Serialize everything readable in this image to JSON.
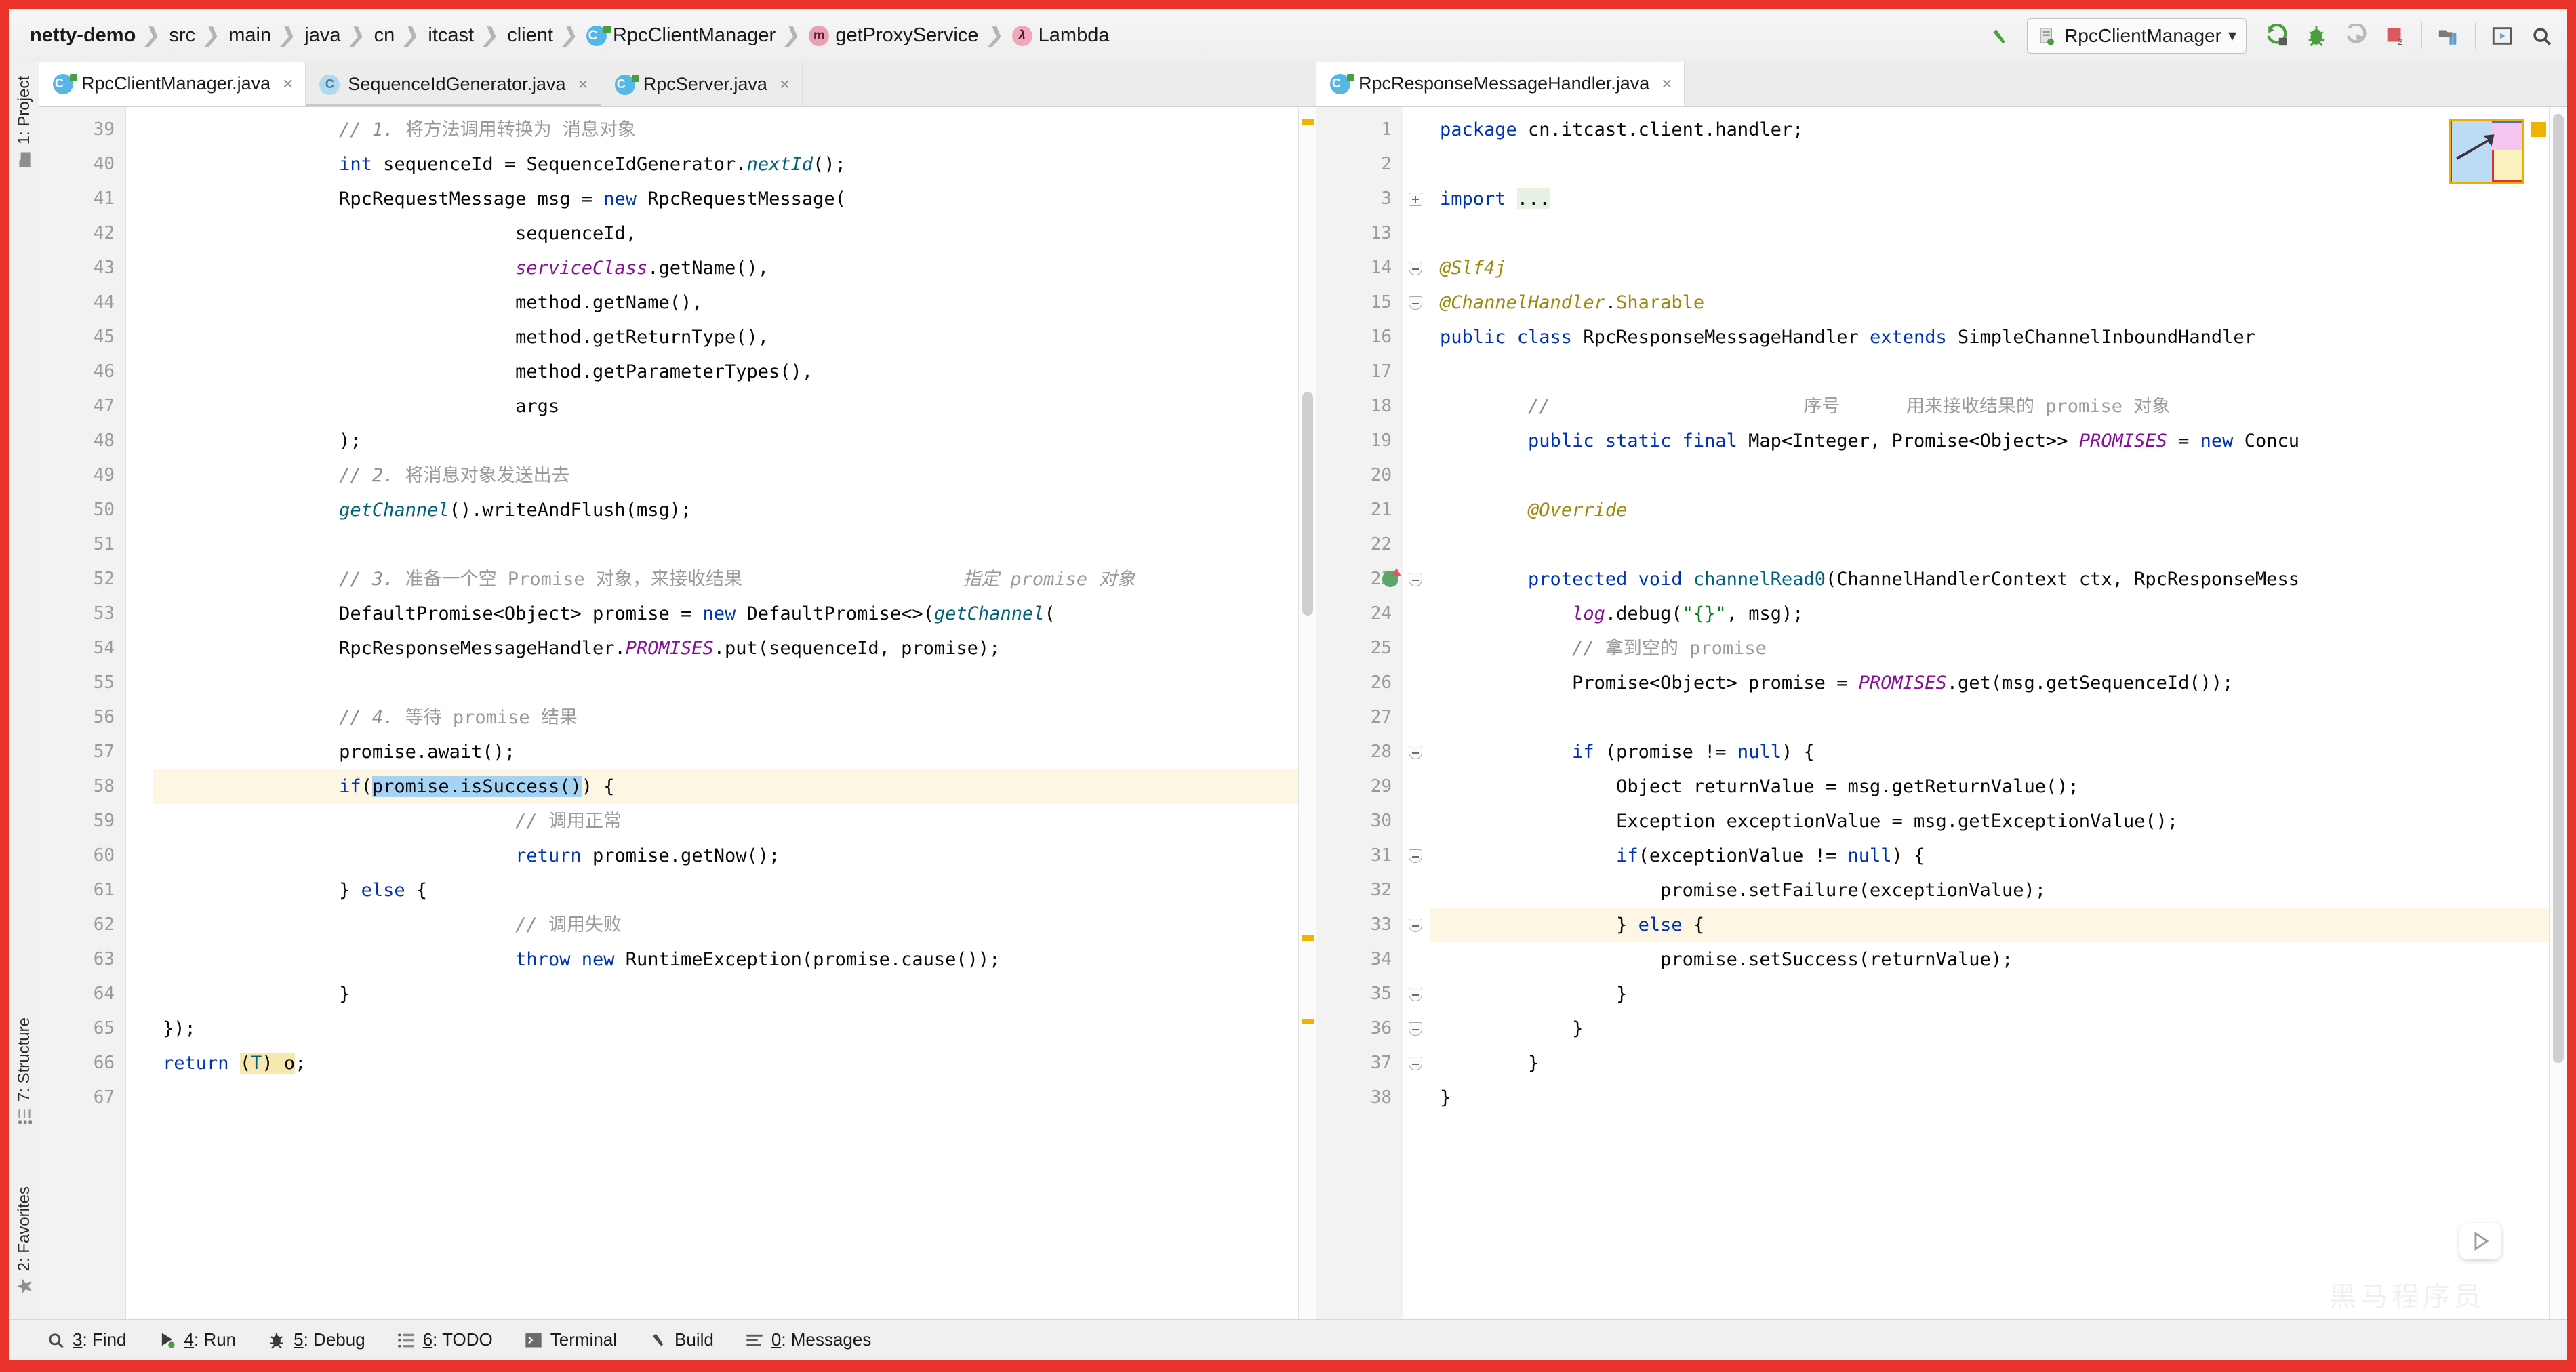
{
  "window": {
    "accent_frame_color": "#e8322a"
  },
  "navbar": {
    "breadcrumbs": [
      {
        "label": "netty-demo",
        "icon": ""
      },
      {
        "label": "src",
        "icon": ""
      },
      {
        "label": "main",
        "icon": ""
      },
      {
        "label": "java",
        "icon": ""
      },
      {
        "label": "cn",
        "icon": ""
      },
      {
        "label": "itcast",
        "icon": ""
      },
      {
        "label": "client",
        "icon": ""
      },
      {
        "label": "RpcClientManager",
        "icon": "class-icon"
      },
      {
        "label": "getProxyService",
        "icon": "method-icon"
      },
      {
        "label": "Lambda",
        "icon": "lambda-icon"
      }
    ],
    "run_config": {
      "name": "RpcClientManager",
      "dropdown": "▾"
    },
    "toolbar_buttons": [
      "back-arrow-icon",
      "run-icon",
      "debug-icon",
      "run-with-coverage-icon",
      "stop-icon",
      "project-structure-icon",
      "preview-icon",
      "search-icon"
    ]
  },
  "left_strip": {
    "top_items": [
      {
        "label": "1: Project",
        "icon": "project-icon"
      }
    ],
    "bottom_items": [
      {
        "label": "7: Structure",
        "icon": "structure-icon"
      },
      {
        "label": "2: Favorites",
        "icon": "star-icon"
      }
    ]
  },
  "editor_left": {
    "tabs": [
      {
        "label": "RpcClientManager.java",
        "active": true,
        "icon": "java-class-icon",
        "close": "×"
      },
      {
        "label": "SequenceIdGenerator.java",
        "active": false,
        "icon": "java-class-icon",
        "close": "×"
      },
      {
        "label": "RpcServer.java",
        "active": false,
        "icon": "java-class-icon",
        "close": "×"
      }
    ],
    "first_line_number": 39,
    "lines": [
      {
        "n": 39,
        "indent": 4,
        "html": "<span class='cmt'>// 1. </span><span class='cmt-zh'>将方法调用转换为 消息对象</span>"
      },
      {
        "n": 40,
        "indent": 4,
        "html": "<span class='kw'>int</span> sequenceId = SequenceIdGenerator.<span class='mth ital'>nextId</span>();"
      },
      {
        "n": 41,
        "indent": 4,
        "html": "RpcRequestMessage msg = <span class='kw'>new</span> RpcRequestMessage("
      },
      {
        "n": 42,
        "indent": 8,
        "html": "sequenceId,"
      },
      {
        "n": 43,
        "indent": 8,
        "html": "<span class='fld'>serviceClass</span>.getName(),"
      },
      {
        "n": 44,
        "indent": 8,
        "html": "method.getName(),"
      },
      {
        "n": 45,
        "indent": 8,
        "html": "method.getReturnType(),"
      },
      {
        "n": 46,
        "indent": 8,
        "html": "method.getParameterTypes(),"
      },
      {
        "n": 47,
        "indent": 8,
        "html": "args"
      },
      {
        "n": 48,
        "indent": 4,
        "html": ");"
      },
      {
        "n": 49,
        "indent": 4,
        "html": "<span class='cmt'>// 2. </span><span class='cmt-zh'>将消息对象发送出去</span>"
      },
      {
        "n": 50,
        "indent": 4,
        "html": "<span class='mth ital'>getChannel</span>().writeAndFlush(msg);"
      },
      {
        "n": 51,
        "indent": 0,
        "html": ""
      },
      {
        "n": 52,
        "indent": 4,
        "html": "<span class='cmt'>// 3. </span><span class='cmt-zh'>准备一个空 Promise 对象，来接收结果</span>                    <span class='hint'>指定 promise 对象</span>"
      },
      {
        "n": 53,
        "indent": 4,
        "html": "DefaultPromise&lt;Object&gt; promise = <span class='kw'>new</span> DefaultPromise&lt;&gt;(<span class='mth ital'>getChannel</span>("
      },
      {
        "n": 54,
        "indent": 4,
        "html": "RpcResponseMessageHandler.<span class='sfld'>PROMISES</span>.put(sequenceId, promise);"
      },
      {
        "n": 55,
        "indent": 0,
        "html": ""
      },
      {
        "n": 56,
        "indent": 4,
        "html": "<span class='cmt'>// 4. </span><span class='cmt-zh'>等待 promise 结果</span>"
      },
      {
        "n": 57,
        "indent": 4,
        "html": "promise.await();"
      },
      {
        "n": 58,
        "indent": 4,
        "html": "<span class='kw'>if</span>(<span class='sel'>promise.isSuccess()</span>) {",
        "highlight": true
      },
      {
        "n": 59,
        "indent": 8,
        "html": "<span class='cmt'>// </span><span class='cmt-zh'>调用正常</span>"
      },
      {
        "n": 60,
        "indent": 8,
        "html": "<span class='kw'>return</span> promise.getNow();"
      },
      {
        "n": 61,
        "indent": 4,
        "html": "} <span class='kw'>else</span> {"
      },
      {
        "n": 62,
        "indent": 8,
        "html": "<span class='cmt'>// </span><span class='cmt-zh'>调用失败</span>"
      },
      {
        "n": 63,
        "indent": 8,
        "html": "<span class='kw'>throw new</span> RuntimeException(promise.cause());"
      },
      {
        "n": 64,
        "indent": 4,
        "html": "}"
      },
      {
        "n": 65,
        "indent": 0,
        "html": "});"
      },
      {
        "n": 66,
        "indent": 0,
        "html": "<span class='kw'>return</span> <span class='cast'>(<span class='mth'>T</span>) o</span>;"
      },
      {
        "n": 67,
        "indent": 0,
        "html": ""
      }
    ]
  },
  "editor_right": {
    "tabs": [
      {
        "label": "RpcResponseMessageHandler.java",
        "active": true,
        "icon": "java-class-icon",
        "close": "×"
      }
    ],
    "lines": [
      {
        "n": 1,
        "indent": 0,
        "html": "<span class='kw'>package</span> cn.itcast.client.handler;"
      },
      {
        "n": 2,
        "indent": 0,
        "html": ""
      },
      {
        "n": 3,
        "indent": 0,
        "html": "<span class='kw'>import</span> <span style='background:#e8f2e2'>...</span>",
        "fold": "plus"
      },
      {
        "n": 13,
        "indent": 0,
        "html": ""
      },
      {
        "n": 14,
        "indent": 0,
        "html": "<span class='fld' style='color:#9e880d'>@Slf4j</span>",
        "fold": "arrowdn"
      },
      {
        "n": 15,
        "indent": 0,
        "html": "<span class='fld' style='color:#9e880d'>@ChannelHandler</span>.<span style='color:#9e880d'>Sharable</span>",
        "fold": "arrowdn"
      },
      {
        "n": 16,
        "indent": 0,
        "html": "<span class='kw'>public class</span> RpcResponseMessageHandler <span class='kw'>extends</span> SimpleChannelInboundHandler"
      },
      {
        "n": 17,
        "indent": 0,
        "html": ""
      },
      {
        "n": 18,
        "indent": 2,
        "html": "<span class='cmt'>//</span>                       <span class='cmt-zh'>序号      用来接收结果的 promise 对象</span>"
      },
      {
        "n": 19,
        "indent": 2,
        "html": "<span class='kw'>public static final</span> Map&lt;Integer, Promise&lt;Object&gt;&gt; <span class='sfld'>PROMISES</span> = <span class='kw'>new</span> Concu"
      },
      {
        "n": 20,
        "indent": 0,
        "html": ""
      },
      {
        "n": 21,
        "indent": 2,
        "html": "<span class='fld' style='color:#9e880d'>@Override</span>"
      },
      {
        "n": 22,
        "indent": 0,
        "html": ""
      },
      {
        "n": 23,
        "indent": 2,
        "html": "<span class='kw'>protected void</span> <span class='mth'>channelRead0</span>(ChannelHandlerContext ctx, RpcResponseMess",
        "fold": "arrowdn",
        "run_marker": true
      },
      {
        "n": 24,
        "indent": 3,
        "html": "<span class='fld'>log</span>.debug(<span class='str'>\"{}\"</span>, msg);"
      },
      {
        "n": 25,
        "indent": 3,
        "html": "<span class='cmt'>// </span><span class='cmt-zh'>拿到空的 promise</span>"
      },
      {
        "n": 26,
        "indent": 3,
        "html": "Promise&lt;Object&gt; promise = <span class='sfld'>PROMISES</span>.get(msg.getSequenceId());"
      },
      {
        "n": 27,
        "indent": 0,
        "html": ""
      },
      {
        "n": 28,
        "indent": 3,
        "html": "<span class='kw'>if</span> (promise != <span class='kw'>null</span>) {",
        "fold": "arrowdn"
      },
      {
        "n": 29,
        "indent": 4,
        "html": "Object returnValue = msg.getReturnValue();"
      },
      {
        "n": 30,
        "indent": 4,
        "html": "Exception exceptionValue = msg.getExceptionValue();"
      },
      {
        "n": 31,
        "indent": 4,
        "html": "<span class='kw'>if</span>(exceptionValue != <span class='kw'>null</span>) {",
        "fold": "arrowdn"
      },
      {
        "n": 32,
        "indent": 5,
        "html": "promise.setFailure(exceptionValue);"
      },
      {
        "n": 33,
        "indent": 4,
        "html": "} <span class='kw'>else</span> {",
        "fold": "arrowdn",
        "highlight": true
      },
      {
        "n": 34,
        "indent": 5,
        "html": "promise.setSuccess(returnValue);"
      },
      {
        "n": 35,
        "indent": 4,
        "html": "}",
        "fold": "arrowdn"
      },
      {
        "n": 36,
        "indent": 3,
        "html": "}",
        "fold": "arrowdn"
      },
      {
        "n": 37,
        "indent": 2,
        "html": "}",
        "fold": "arrowdn"
      },
      {
        "n": 38,
        "indent": 0,
        "html": "}"
      }
    ]
  },
  "statusbar": {
    "tools": [
      {
        "label": "3: Find",
        "key": "3",
        "rest": ": Find",
        "icon": "search-icon"
      },
      {
        "label": "4: Run",
        "key": "4",
        "rest": ": Run",
        "icon": "run-icon"
      },
      {
        "label": "5: Debug",
        "key": "5",
        "rest": ": Debug",
        "icon": "debug-icon"
      },
      {
        "label": "6: TODO",
        "key": "6",
        "rest": ": TODO",
        "icon": "todo-icon"
      },
      {
        "label": "Terminal",
        "key": "",
        "rest": "Terminal",
        "icon": "terminal-icon"
      },
      {
        "label": "Build",
        "key": "",
        "rest": "Build",
        "icon": "build-icon"
      },
      {
        "label": "0: Messages",
        "key": "0",
        "rest": ": Messages",
        "icon": "messages-icon"
      }
    ]
  },
  "watermark": {
    "text": "黑马程序员"
  }
}
